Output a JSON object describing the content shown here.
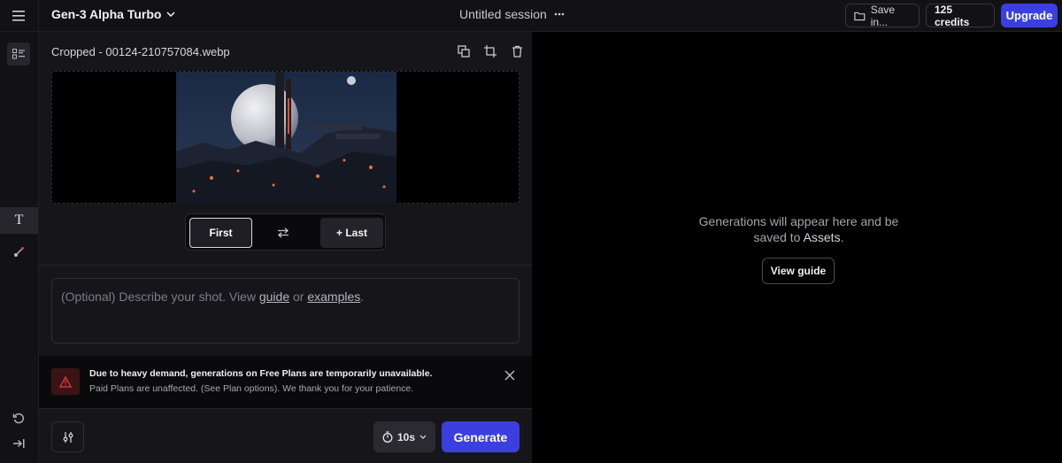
{
  "header": {
    "model_name": "Gen-3 Alpha Turbo",
    "session_title": "Untitled session",
    "save_label": "Save in...",
    "credits_label": "125 credits",
    "upgrade_label": "Upgrade"
  },
  "rail": {
    "icons": [
      "list-icon",
      "text-icon",
      "brush-icon",
      "reset-icon",
      "collapse-icon"
    ]
  },
  "panel": {
    "file_name": "Cropped - 00124-210757084.webp",
    "keyframes": {
      "first_label": "First",
      "last_label": "+ Last"
    },
    "prompt": {
      "prefix": "(Optional) Describe your shot. View ",
      "guide_link": "guide",
      "middle": " or ",
      "examples_link": "examples",
      "suffix": "."
    },
    "notice": {
      "title": "Due to heavy demand, generations on Free Plans are temporarily unavailable.",
      "body": "Paid Plans are unaffected. (See Plan options). We thank you for your patience."
    },
    "duration_label": "10s",
    "generate_label": "Generate"
  },
  "output": {
    "message_line1": "Generations will appear here and be",
    "message_line2_prefix": "saved to ",
    "message_line2_link": "Assets",
    "message_line2_suffix": ".",
    "guide_button": "View guide"
  },
  "colors": {
    "accent": "#3b3fe0",
    "background": "#0b0b0d",
    "panel": "#16161a",
    "warning": "#e04040"
  }
}
